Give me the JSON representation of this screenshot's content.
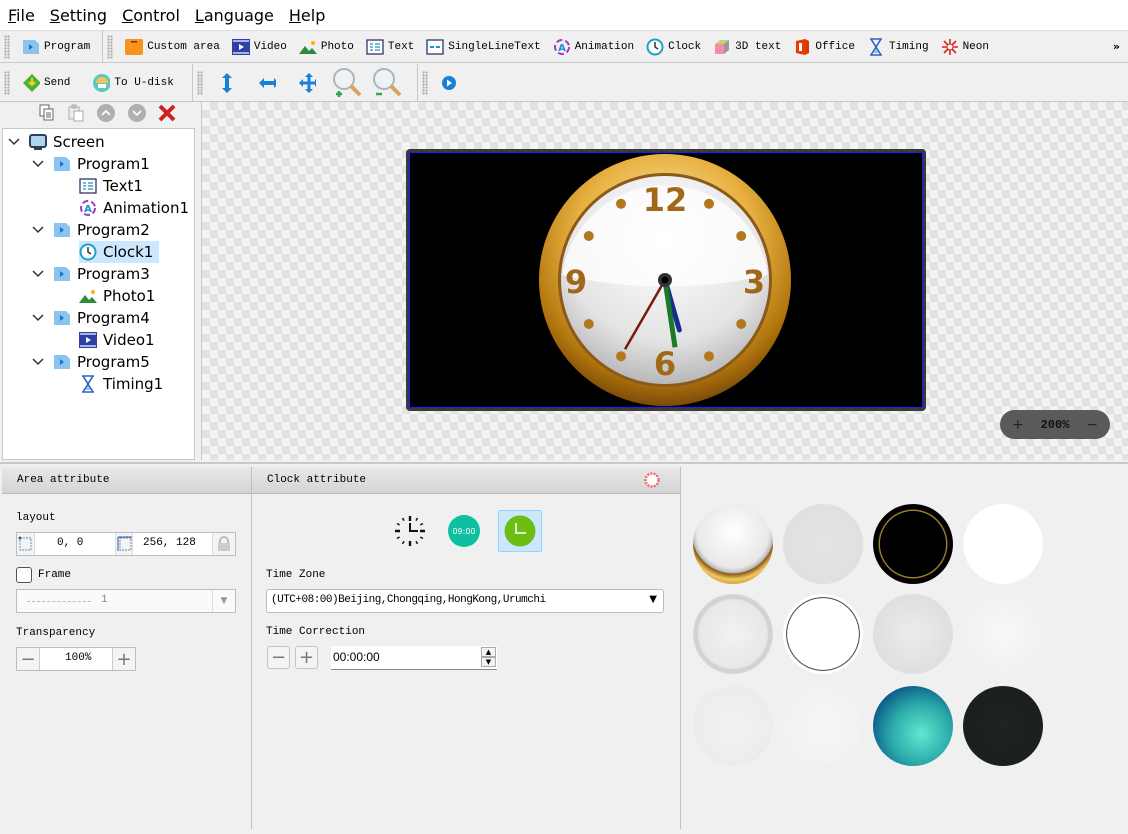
{
  "menubar": {
    "items": [
      {
        "label": "File",
        "mnemonic": "F",
        "rest": "ile"
      },
      {
        "label": "Setting",
        "mnemonic": "S",
        "rest": "etting"
      },
      {
        "label": "Control",
        "mnemonic": "C",
        "rest": "ontrol"
      },
      {
        "label": "Language",
        "mnemonic": "L",
        "rest": "anguage"
      },
      {
        "label": "Help",
        "mnemonic": "H",
        "rest": "elp"
      }
    ]
  },
  "toolbar1": {
    "program": "Program",
    "custom_area": "Custom area",
    "video": "Video",
    "photo": "Photo",
    "text": "Text",
    "single_line_text": "SingleLineText",
    "animation": "Animation",
    "clock": "Clock",
    "text3d": "3D text",
    "office": "Office",
    "timing": "Timing",
    "neon": "Neon",
    "overflow": "»"
  },
  "toolbar2": {
    "send": "Send",
    "to_udisk": "To U-disk"
  },
  "tree": {
    "nodes": [
      {
        "label": "Screen",
        "type": "screen"
      },
      {
        "label": "Program1",
        "type": "program"
      },
      {
        "label": "Text1",
        "type": "text"
      },
      {
        "label": "Animation1",
        "type": "animation"
      },
      {
        "label": "Program2",
        "type": "program"
      },
      {
        "label": "Clock1",
        "type": "clock",
        "selected": true
      },
      {
        "label": "Program3",
        "type": "program"
      },
      {
        "label": "Photo1",
        "type": "photo"
      },
      {
        "label": "Program4",
        "type": "program"
      },
      {
        "label": "Video1",
        "type": "video"
      },
      {
        "label": "Program5",
        "type": "program"
      },
      {
        "label": "Timing1",
        "type": "timing"
      }
    ]
  },
  "canvas": {
    "zoom_label": "200%",
    "zoom_in": "+",
    "zoom_out": "−",
    "clock_numerals": [
      "12",
      "3",
      "6",
      "9"
    ],
    "clock_time": {
      "hour": 5,
      "minute": 28,
      "second": 35
    }
  },
  "area_attr": {
    "title": "Area attribute",
    "layout_label": "layout",
    "position": "0, 0",
    "size": "256, 128",
    "frame_label": "Frame",
    "frame_checked": false,
    "frame_value": "1",
    "transparency_label": "Transparency",
    "transparency_value": "100%"
  },
  "clock_attr": {
    "title": "Clock attribute",
    "styles": [
      "analog-ticks",
      "digital-09:00",
      "analog-green"
    ],
    "digital_text": "09:00",
    "selected_style": 2,
    "time_zone_label": "Time Zone",
    "time_zone_value": "(UTC+08:00)Beijing,Chongqing,HongKong,Urumchi",
    "time_correction_label": "Time Correction",
    "time_correction_value": "00:00:00"
  },
  "clock_gallery": {
    "items": [
      "gold-classic",
      "gray-pink-numbers",
      "black-gold-roman",
      "white-roman",
      "silver-ring",
      "black-white-roman",
      "red-ring",
      "silver-arabic",
      "white-red-marks",
      "black-ring-arabic",
      "teal-dolphin",
      "dark-green-numbers"
    ],
    "selected": 0
  }
}
